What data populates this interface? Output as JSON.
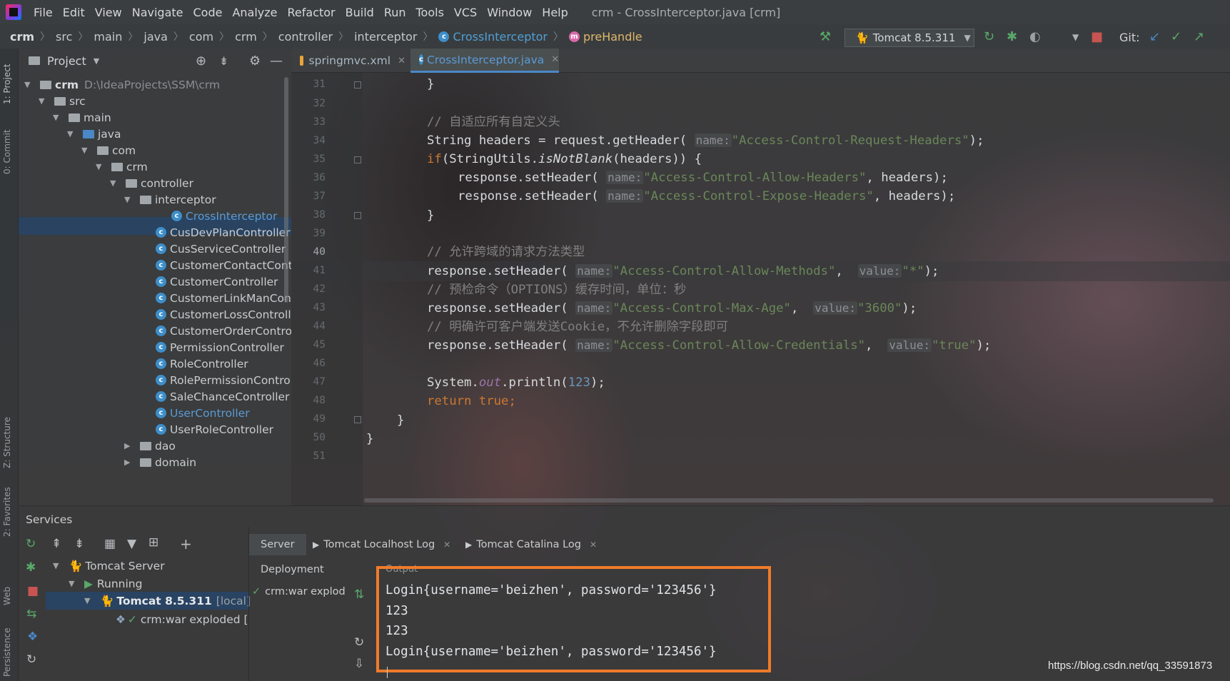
{
  "app": {
    "menus": [
      "File",
      "Edit",
      "View",
      "Navigate",
      "Code",
      "Analyze",
      "Refactor",
      "Build",
      "Run",
      "Tools",
      "VCS",
      "Window",
      "Help"
    ],
    "window_title": "crm - CrossInterceptor.java [crm]"
  },
  "breadcrumb": [
    "crm",
    "src",
    "main",
    "java",
    "com",
    "crm",
    "controller",
    "interceptor",
    "CrossInterceptor",
    "preHandle"
  ],
  "toolbar": {
    "run_config": "Tomcat 8.5.311",
    "git_label": "Git:"
  },
  "left_strip": {
    "project": "1: Project",
    "commit": "0: Commit",
    "structure": "Z: Structure",
    "favorites": "2: Favorites",
    "web": "Web",
    "persistence": "Persistence"
  },
  "project": {
    "title": "Project",
    "root_name": "crm",
    "root_path": "D:\\IdeaProjects\\SSM\\crm",
    "nodes": [
      "src",
      "main",
      "java",
      "com",
      "crm",
      "controller",
      "interceptor"
    ],
    "controllers": [
      "CrossInterceptor",
      "CusDevPlanController",
      "CusServiceController",
      "CustomerContactContr",
      "CustomerController",
      "CustomerLinkManCont",
      "CustomerLossControlle",
      "CustomerOrderControl",
      "PermissionController",
      "RoleController",
      "RolePermissionControl",
      "SaleChanceController",
      "UserController",
      "UserRoleController"
    ],
    "more": [
      "dao",
      "domain"
    ]
  },
  "editor": {
    "tabs": [
      "springmvc.xml",
      "CrossInterceptor.java"
    ],
    "line_numbers": [
      "31",
      "32",
      "33",
      "34",
      "35",
      "36",
      "37",
      "38",
      "39",
      "40",
      "41",
      "42",
      "43",
      "44",
      "45",
      "46",
      "47",
      "48",
      "49",
      "50",
      "51"
    ],
    "current_line": "40",
    "lines": {
      "l31": "}",
      "l33": "// 自适应所有自定义头",
      "l34_a": "String headers = request.getHeader(",
      "l34_h": "name:",
      "l34_s": "\"Access-Control-Request-Headers\"",
      "l34_b": ");",
      "l35_kw": "if",
      "l35_a": "(StringUtils.",
      "l35_i": "isNotBlank",
      "l35_b": "(headers)) {",
      "l36_a": "response.setHeader(",
      "l36_h": "name:",
      "l36_s": "\"Access-Control-Allow-Headers\"",
      "l36_b": ", headers);",
      "l37_a": "response.setHeader(",
      "l37_h": "name:",
      "l37_s": "\"Access-Control-Expose-Headers\"",
      "l37_b": ", headers);",
      "l38": "}",
      "l40": "// 允许跨域的请求方法类型",
      "l41_a": "response.setHeader(",
      "l41_h": "name:",
      "l41_s": "\"Access-Control-Allow-Methods\"",
      "l41_c": ",",
      "l41_h2": "value:",
      "l41_s2": "\"*\"",
      "l41_b": ");",
      "l42": "// 预检命令（OPTIONS）缓存时间，单位：秒",
      "l43_a": "response.setHeader(",
      "l43_h": "name:",
      "l43_s": "\"Access-Control-Max-Age\"",
      "l43_c": ",",
      "l43_h2": "value:",
      "l43_s2": "\"3600\"",
      "l43_b": ");",
      "l44": "// 明确许可客户端发送Cookie，不允许删除字段即可",
      "l45_a": "response.setHeader(",
      "l45_h": "name:",
      "l45_s": "\"Access-Control-Allow-Credentials\"",
      "l45_c": ",",
      "l45_h2": "value:",
      "l45_s2": "\"true\"",
      "l45_b": ");",
      "l47_a": "System.",
      "l47_f": "out",
      "l47_b": ".println(",
      "l47_n": "123",
      "l47_c": ");",
      "l48_kw": "return true",
      "l48_b": ";",
      "l49": "}",
      "l50": "}"
    }
  },
  "services": {
    "title": "Services",
    "tree": {
      "server": "Tomcat Server",
      "running": "Running",
      "tomcat": "Tomcat 8.5.311",
      "tomcat_suffix": "[local]",
      "artifact": "crm:war exploded ["
    },
    "tabs": [
      "Server",
      "Tomcat Localhost Log",
      "Tomcat Catalina Log"
    ],
    "deployment_label": "Deployment",
    "deployment_item": "crm:war explod",
    "output_label": "Output",
    "output": [
      "Login{username='beizhen', password='123456'}",
      "123",
      "123",
      "Login{username='beizhen', password='123456'}"
    ]
  },
  "watermark": "https://blog.csdn.net/qq_33591873",
  "colors": {
    "accent": "#4a88c7",
    "highlight_box": "#f07b2a",
    "string": "#6a8759",
    "keyword": "#cc7832",
    "comment": "#808080"
  }
}
